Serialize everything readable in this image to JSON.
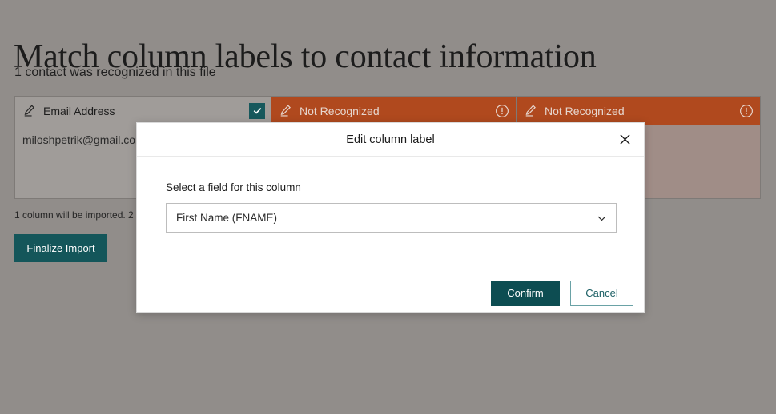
{
  "page": {
    "title": "Match column labels to contact information",
    "subtitle": "1 contact was recognized in this file",
    "import_note": "1 column will be imported. 2 colum",
    "finalize_button": "Finalize Import",
    "accent_teal": "#14565a",
    "warning_orange": "#b0491e",
    "overlay_gray": "#918d8a"
  },
  "table": {
    "columns": [
      {
        "label": "Email Address",
        "state": "recognized",
        "status_icon": "check-icon",
        "edit_icon": "pencil-icon",
        "sample_value": "miloshpetrik@gmail.com"
      },
      {
        "label": "Not Recognized",
        "state": "unrecognized",
        "status_icon": "warning-circle-icon",
        "edit_icon": "pencil-icon",
        "sample_value": ""
      },
      {
        "label": "Not Recognized",
        "state": "unrecognized",
        "status_icon": "warning-circle-icon",
        "edit_icon": "pencil-icon",
        "sample_value": ""
      }
    ]
  },
  "modal": {
    "title": "Edit column label",
    "close_icon": "close-icon",
    "field_label": "Select a field for this column",
    "field_value": "First Name (FNAME)",
    "field_chevron_icon": "chevron-down-icon",
    "confirm_label": "Confirm",
    "cancel_label": "Cancel"
  }
}
